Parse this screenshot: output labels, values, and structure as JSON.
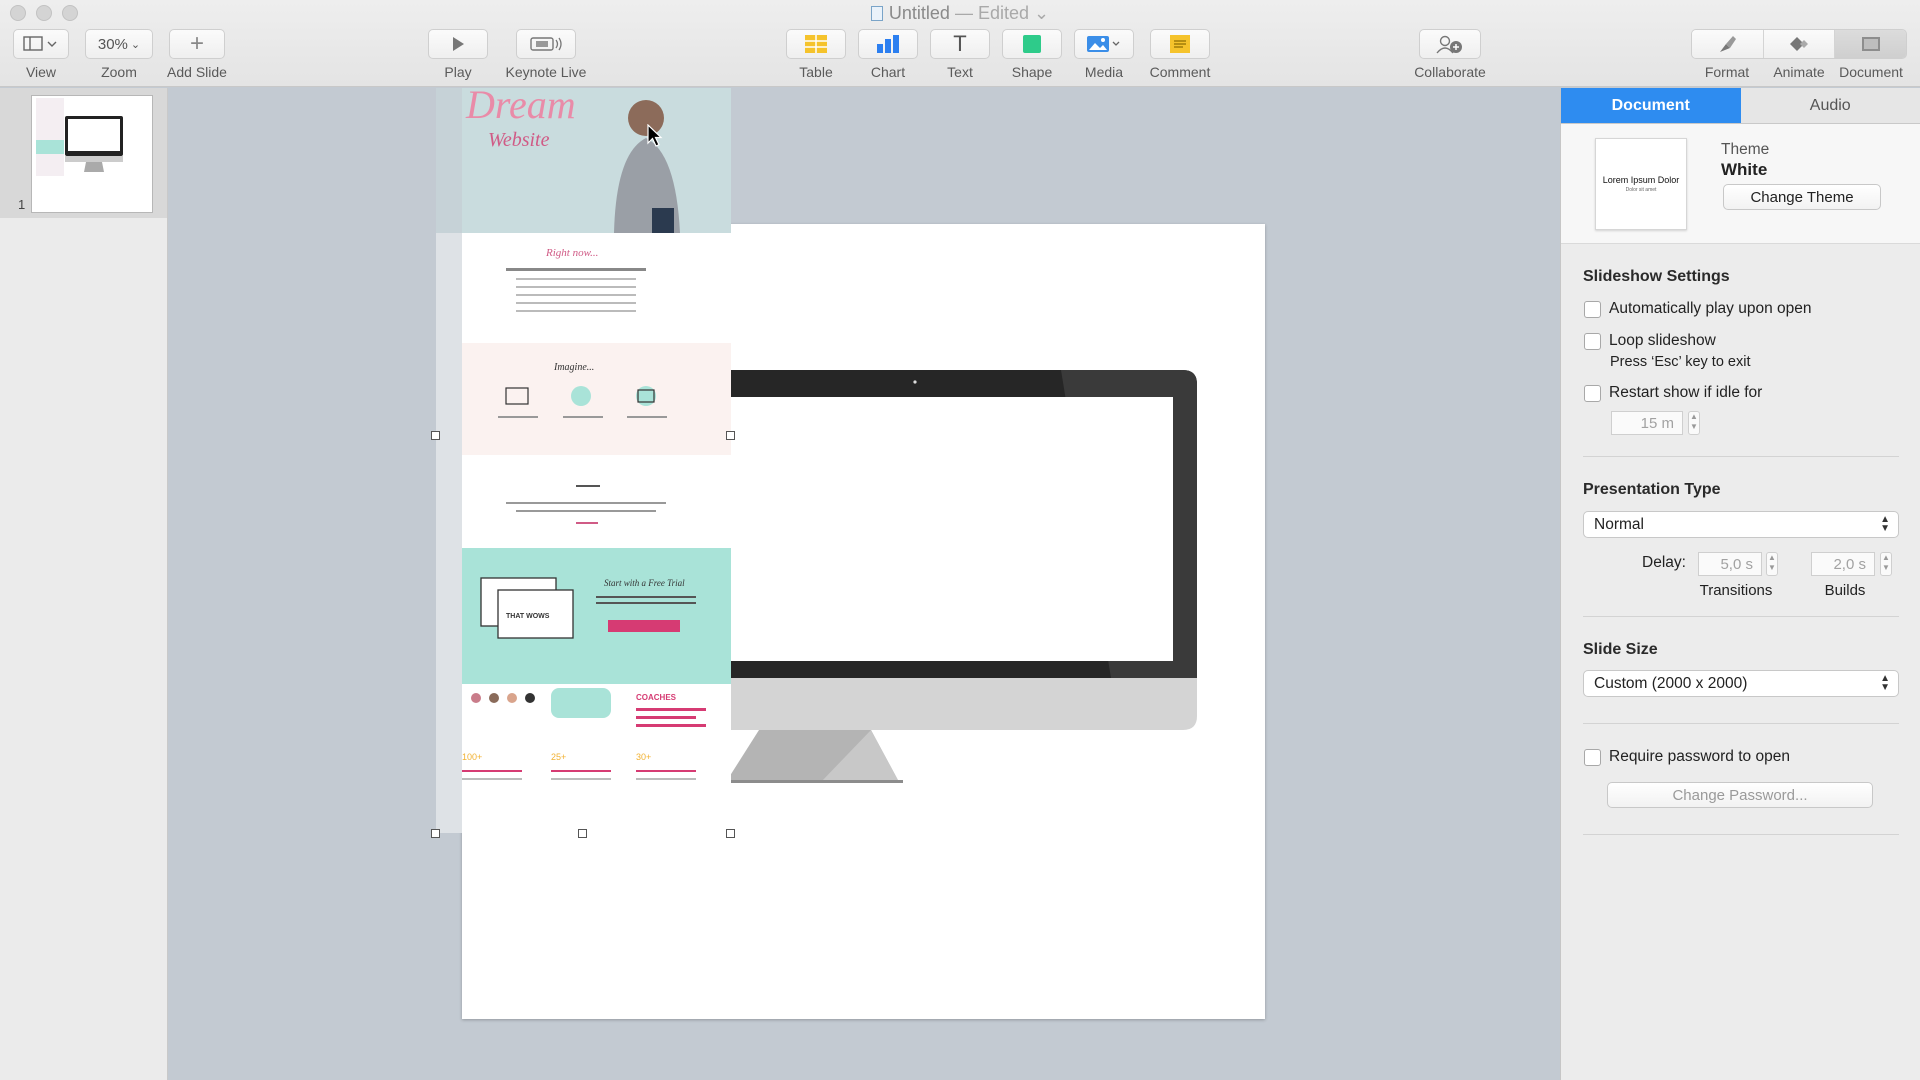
{
  "window": {
    "title": "Untitled",
    "status": "— Edited",
    "title_menu": "⌄"
  },
  "toolbar": {
    "view": {
      "label": "View",
      "icon": "sidebar-view-icon"
    },
    "zoom": {
      "label": "Zoom",
      "value": "30%"
    },
    "add_slide": {
      "label": "Add Slide",
      "icon": "plus-icon"
    },
    "play": {
      "label": "Play",
      "icon": "play-icon"
    },
    "keynote_live": {
      "label": "Keynote Live",
      "icon": "keynote-live-icon"
    },
    "table": {
      "label": "Table",
      "icon": "table-icon",
      "color": "#f5c32c"
    },
    "chart": {
      "label": "Chart",
      "icon": "chart-icon",
      "color": "#2c7ff0"
    },
    "text": {
      "label": "Text",
      "icon": "text-icon",
      "glyph": "T"
    },
    "shape": {
      "label": "Shape",
      "icon": "shape-icon",
      "color": "#2ecb8a"
    },
    "media": {
      "label": "Media",
      "icon": "media-icon",
      "color": "#3b8ee8"
    },
    "comment": {
      "label": "Comment",
      "icon": "comment-icon",
      "color": "#f5c32c"
    },
    "collaborate": {
      "label": "Collaborate",
      "icon": "collaborate-icon"
    },
    "format": {
      "label": "Format",
      "icon": "paintbrush-icon"
    },
    "animate": {
      "label": "Animate",
      "icon": "diamond-icon"
    },
    "document": {
      "label": "Document",
      "icon": "document-icon"
    }
  },
  "navigator": {
    "slides": [
      {
        "number": "1"
      }
    ]
  },
  "inspector": {
    "tabs": [
      {
        "label": "Document",
        "active": true
      },
      {
        "label": "Audio",
        "active": false
      }
    ],
    "theme": {
      "preview_title": "Lorem Ipsum Dolor",
      "preview_subtitle": "Dolor sit amet",
      "caption": "Theme",
      "name": "White",
      "change_button": "Change Theme"
    },
    "slideshow": {
      "title": "Slideshow Settings",
      "auto_play": {
        "label": "Automatically play upon open",
        "checked": false
      },
      "loop": {
        "label": "Loop slideshow",
        "checked": false,
        "hint": "Press ‘Esc’ key to exit"
      },
      "restart": {
        "label": "Restart show if idle for",
        "checked": false,
        "value": "15 m"
      }
    },
    "presentation_type": {
      "title": "Presentation Type",
      "selected": "Normal",
      "delay_label": "Delay:",
      "transitions_value": "5,0 s",
      "transitions_label": "Transitions",
      "builds_value": "2,0 s",
      "builds_label": "Builds"
    },
    "slide_size": {
      "title": "Slide Size",
      "selected": "Custom (2000 x 2000)"
    },
    "password": {
      "label": "Require password to open",
      "checked": false,
      "button": "Change Password..."
    }
  },
  "canvas": {
    "screenshot_texts": {
      "hero": "Dream",
      "hero_sub": "Website",
      "right_now": "Right now...",
      "imagine": "Imagine...",
      "trial": "Start with a Free Trial",
      "wows": "THAT WOWS",
      "coaches": "COACHES",
      "stat1": "100+",
      "stat2": "25+",
      "stat3": "30+"
    }
  }
}
